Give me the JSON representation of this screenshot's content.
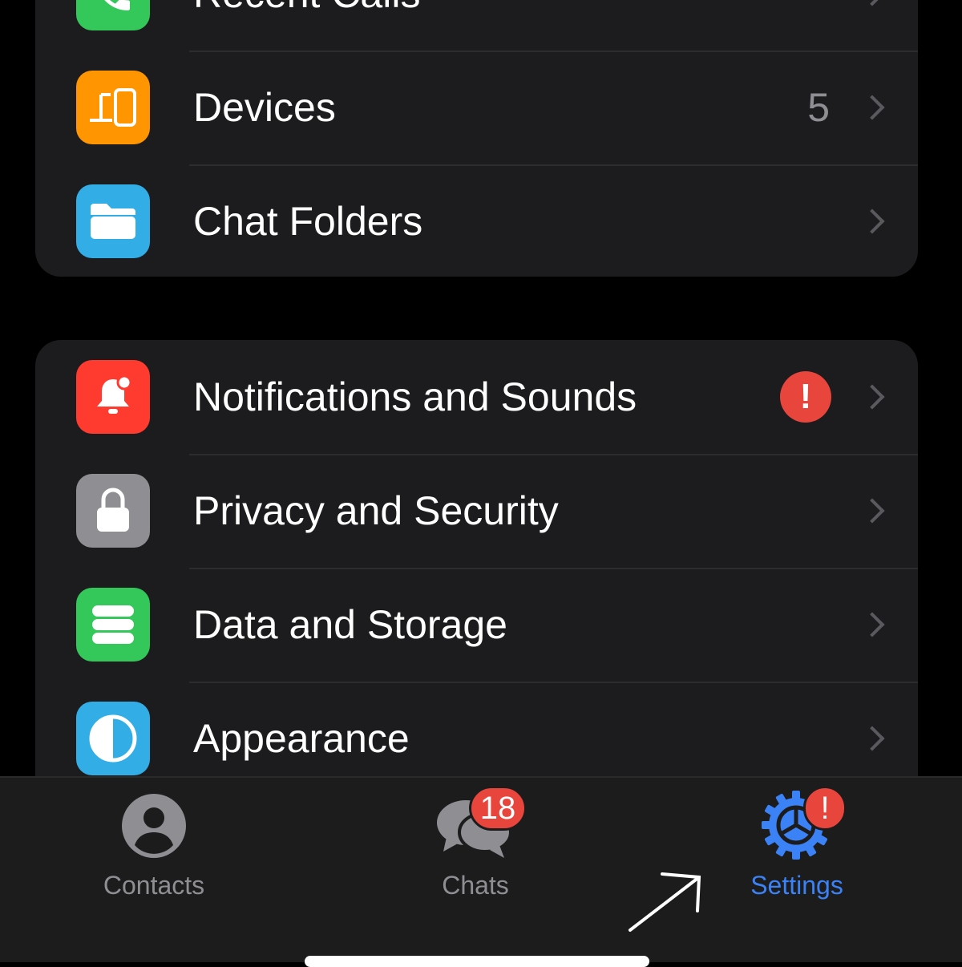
{
  "groups": [
    {
      "items": [
        {
          "label": "Recent Calls",
          "icon": "phone-icon",
          "color": "#34c759"
        },
        {
          "label": "Devices",
          "icon": "devices-icon",
          "color": "#ff9500",
          "value": "5"
        },
        {
          "label": "Chat Folders",
          "icon": "folder-icon",
          "color": "#32ade6"
        }
      ]
    },
    {
      "items": [
        {
          "label": "Notifications and Sounds",
          "icon": "bell-icon",
          "color": "#ff3b30",
          "alert": "!"
        },
        {
          "label": "Privacy and Security",
          "icon": "lock-icon",
          "color": "#8e8e93"
        },
        {
          "label": "Data and Storage",
          "icon": "database-icon",
          "color": "#34c759"
        },
        {
          "label": "Appearance",
          "icon": "half-circle-icon",
          "color": "#32ade6"
        }
      ]
    }
  ],
  "tabbar": {
    "contacts": {
      "label": "Contacts"
    },
    "chats": {
      "label": "Chats",
      "badge": "18"
    },
    "settings": {
      "label": "Settings",
      "badge": "!",
      "active_color": "#3b82f6"
    }
  }
}
